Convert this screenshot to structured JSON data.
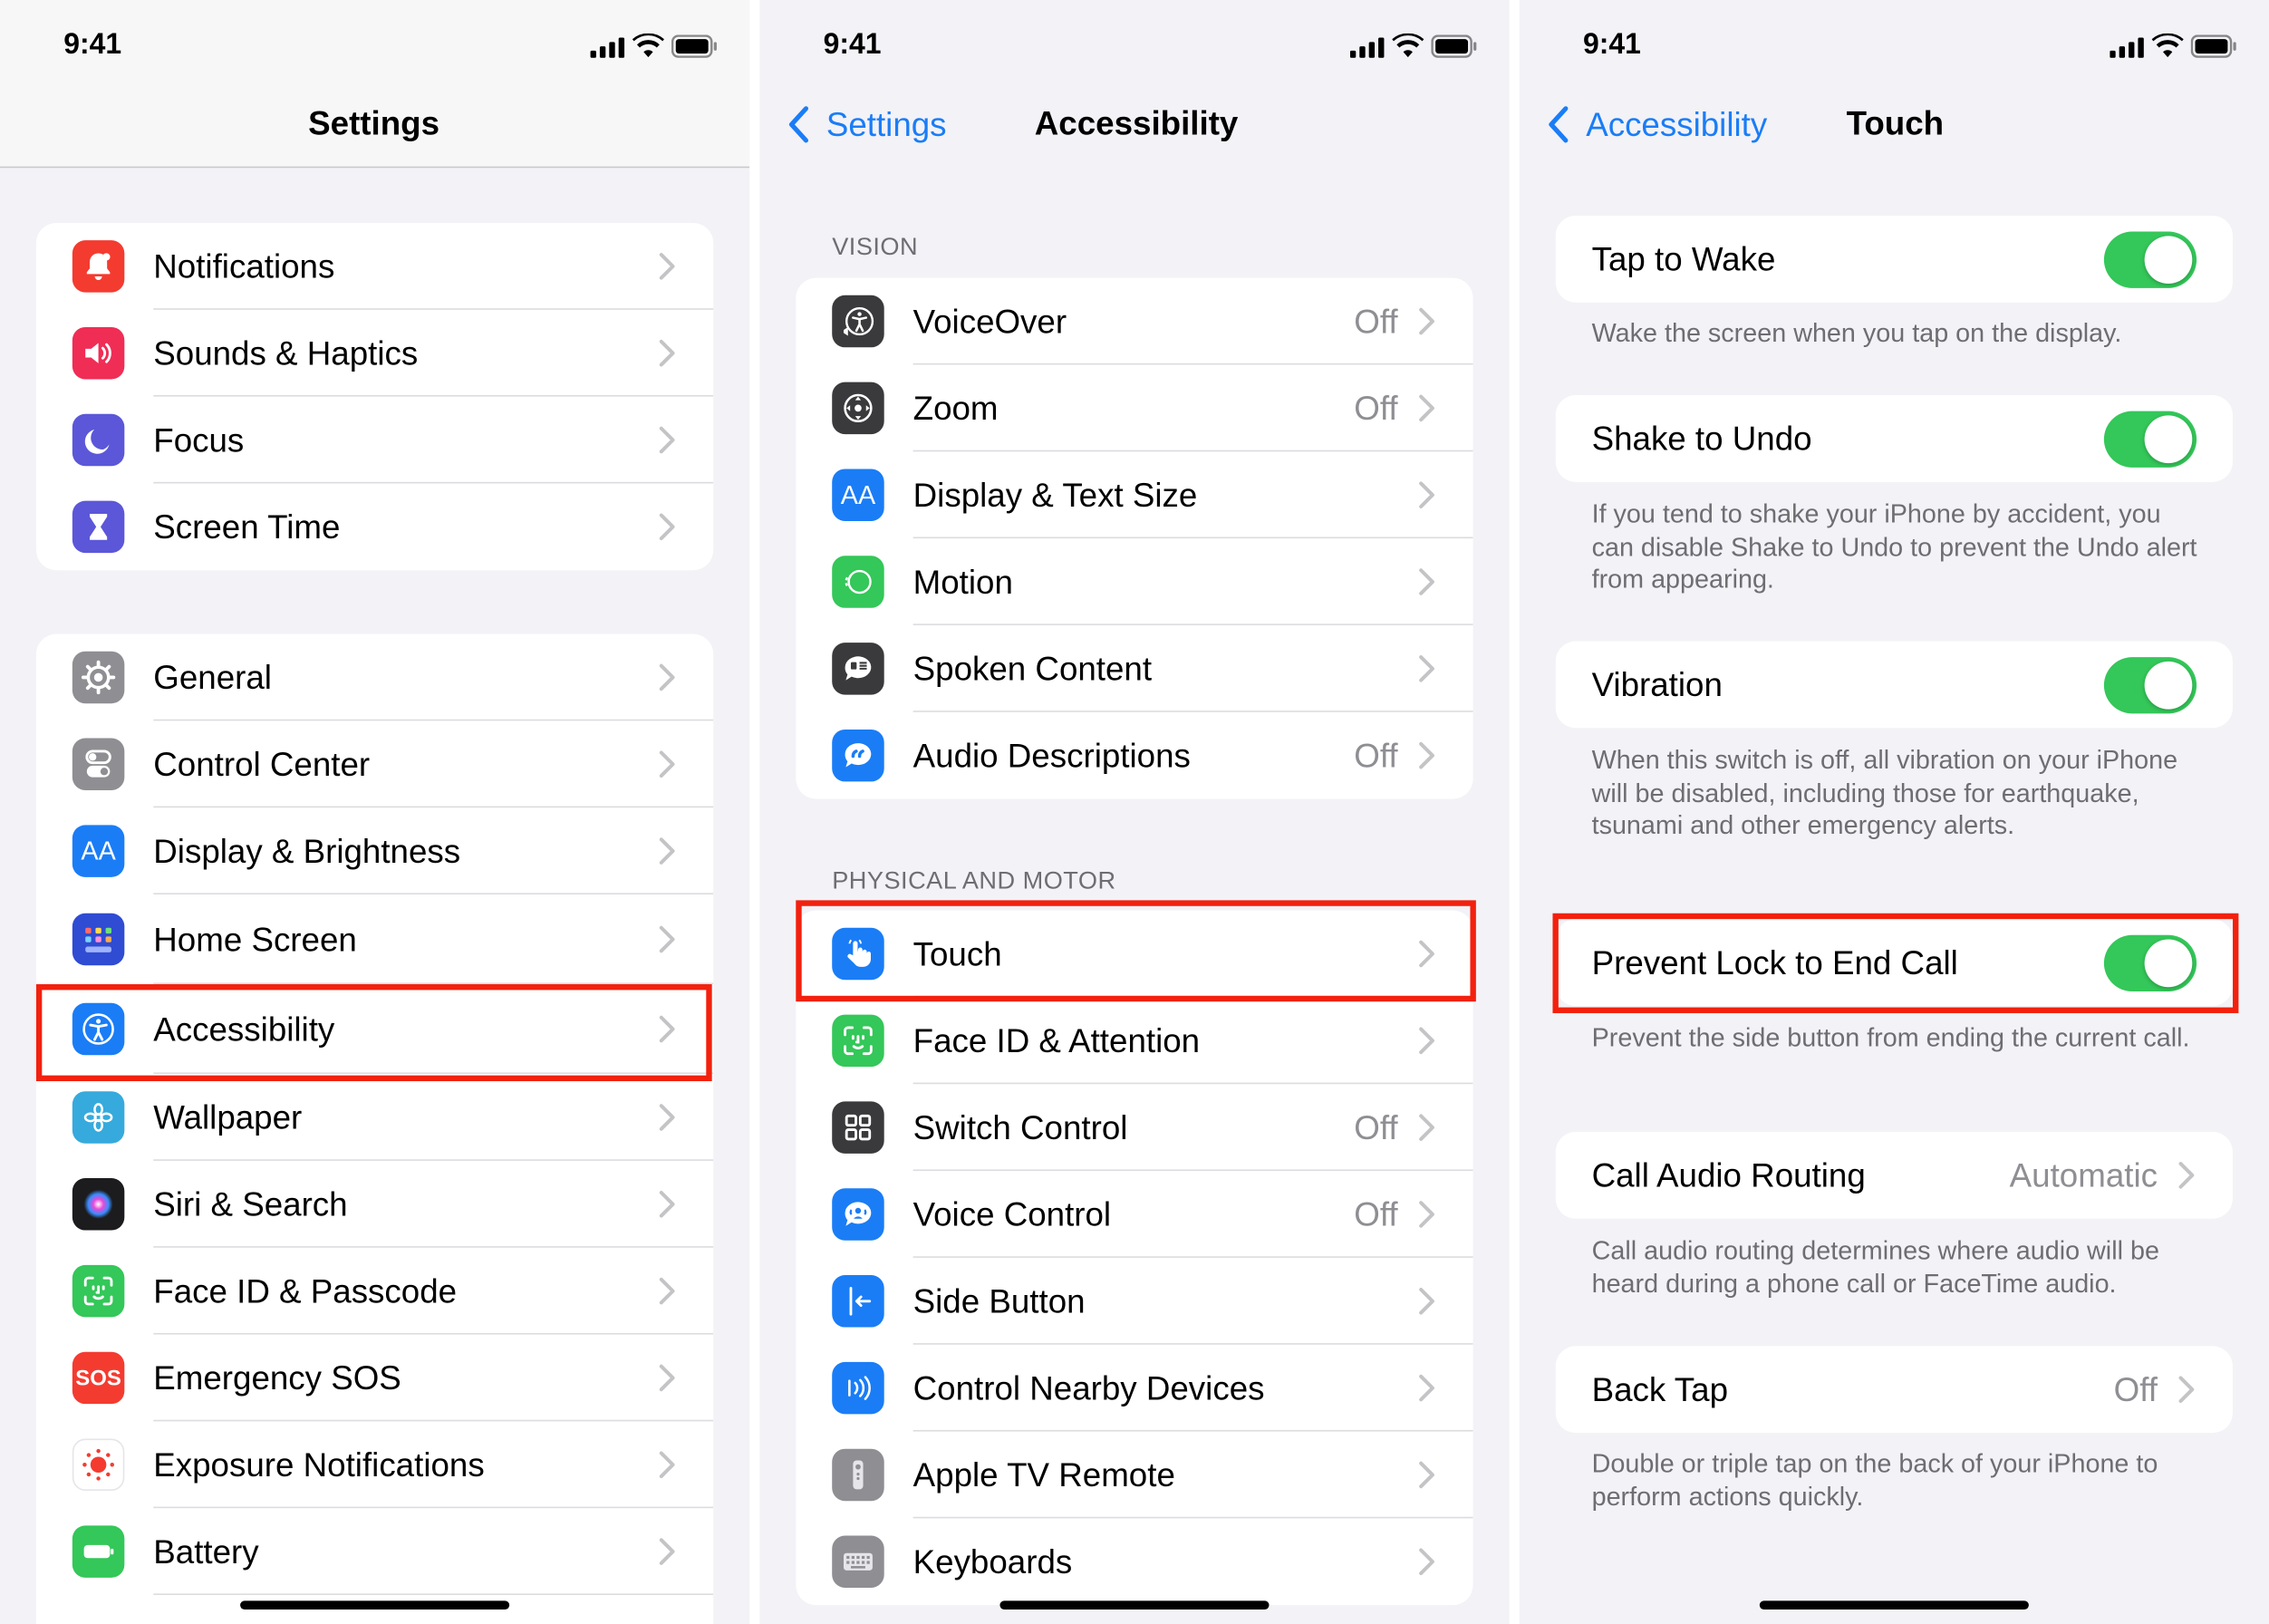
{
  "panels": {
    "settings": {
      "time": "9:41",
      "title": "Settings",
      "group1": [
        {
          "label": "Notifications",
          "icon": "bell-icon",
          "color": "#f43b30"
        },
        {
          "label": "Sounds & Haptics",
          "icon": "speaker-icon",
          "color": "#f02d55"
        },
        {
          "label": "Focus",
          "icon": "moon-icon",
          "color": "#5b57d8"
        },
        {
          "label": "Screen Time",
          "icon": "hourglass-icon",
          "color": "#5b57d8"
        }
      ],
      "group2": [
        {
          "label": "General",
          "icon": "gear-icon",
          "color": "#8e8e93"
        },
        {
          "label": "Control Center",
          "icon": "toggles-icon",
          "color": "#8e8e93"
        },
        {
          "label": "Display & Brightness",
          "icon": "textsize-icon",
          "color": "#1a7df6"
        },
        {
          "label": "Home Screen",
          "icon": "app-grid-icon",
          "color": "#2f4cd3"
        },
        {
          "label": "Accessibility",
          "icon": "accessibility-icon",
          "color": "#1a7df6"
        },
        {
          "label": "Wallpaper",
          "icon": "flower-icon",
          "color": "#36aadc"
        },
        {
          "label": "Siri & Search",
          "icon": "siri-icon",
          "color": "#1c1c1e"
        },
        {
          "label": "Face ID & Passcode",
          "icon": "faceid-icon",
          "color": "#34c759"
        },
        {
          "label": "Emergency SOS",
          "icon": "sos-icon",
          "color": "#f43b30"
        },
        {
          "label": "Exposure Notifications",
          "icon": "exposure-icon",
          "color": "#ffffff"
        },
        {
          "label": "Battery",
          "icon": "battery-icon",
          "color": "#34c759"
        }
      ]
    },
    "accessibility": {
      "time": "9:41",
      "back": "Settings",
      "title": "Accessibility",
      "vision_header": "VISION",
      "vision": [
        {
          "label": "VoiceOver",
          "value": "Off",
          "icon": "voiceover-icon",
          "color": "#3a3a3c"
        },
        {
          "label": "Zoom",
          "value": "Off",
          "icon": "zoom-icon",
          "color": "#3a3a3c"
        },
        {
          "label": "Display & Text Size",
          "value": "",
          "icon": "textsize-icon",
          "color": "#1a7df6"
        },
        {
          "label": "Motion",
          "value": "",
          "icon": "motion-icon",
          "color": "#34c759"
        },
        {
          "label": "Spoken Content",
          "value": "",
          "icon": "spoken-icon",
          "color": "#3a3a3c"
        },
        {
          "label": "Audio Descriptions",
          "value": "Off",
          "icon": "audio-desc-icon",
          "color": "#1a7df6"
        }
      ],
      "physical_header": "PHYSICAL AND MOTOR",
      "physical": [
        {
          "label": "Touch",
          "value": "",
          "icon": "hand-icon",
          "color": "#1a7df6"
        },
        {
          "label": "Face ID & Attention",
          "value": "",
          "icon": "faceid-icon",
          "color": "#34c759"
        },
        {
          "label": "Switch Control",
          "value": "Off",
          "icon": "grid-icon",
          "color": "#3a3a3c"
        },
        {
          "label": "Voice Control",
          "value": "Off",
          "icon": "voice-icon",
          "color": "#1a7df6"
        },
        {
          "label": "Side Button",
          "value": "",
          "icon": "side-button-icon",
          "color": "#1a7df6"
        },
        {
          "label": "Control Nearby Devices",
          "value": "",
          "icon": "nearby-icon",
          "color": "#1a7df6"
        },
        {
          "label": "Apple TV Remote",
          "value": "",
          "icon": "remote-icon",
          "color": "#8e8e93"
        },
        {
          "label": "Keyboards",
          "value": "",
          "icon": "keyboard-icon",
          "color": "#8e8e93"
        }
      ]
    },
    "touch": {
      "time": "9:41",
      "back": "Accessibility",
      "title": "Touch",
      "tap_to_wake": {
        "label": "Tap to Wake",
        "on": true,
        "footer": "Wake the screen when you tap on the display."
      },
      "shake_to_undo": {
        "label": "Shake to Undo",
        "on": true,
        "footer": "If you tend to shake your iPhone by accident, you can disable Shake to Undo to prevent the Undo alert from appearing."
      },
      "vibration": {
        "label": "Vibration",
        "on": true,
        "footer": "When this switch is off, all vibration on your iPhone will be disabled, including those for earthquake, tsunami and other emergency alerts."
      },
      "prevent_lock": {
        "label": "Prevent Lock to End Call",
        "on": true,
        "footer": "Prevent the side button from ending the current call."
      },
      "call_audio": {
        "label": "Call Audio Routing",
        "value": "Automatic",
        "footer": "Call audio routing determines where audio will be heard during a phone call or FaceTime audio."
      },
      "back_tap": {
        "label": "Back Tap",
        "value": "Off",
        "footer": "Double or triple tap on the back of your iPhone to perform actions quickly."
      }
    }
  },
  "highlight_color": "#f2210e",
  "toggle_color": "#34c759",
  "link_color": "#1a7df6"
}
